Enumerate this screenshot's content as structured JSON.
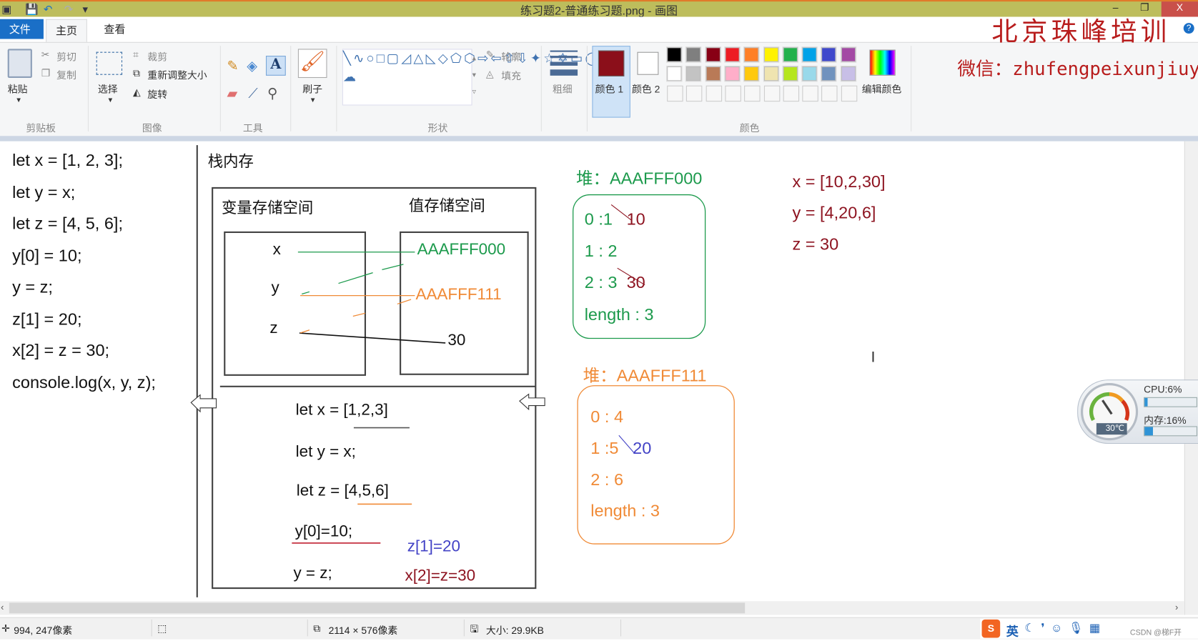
{
  "window": {
    "title": "练习题2-普通练习题.png - 画图",
    "minimize": "–",
    "restore": "❐",
    "close": "X"
  },
  "tabs": [
    {
      "label": "文件"
    },
    {
      "label": "主页"
    },
    {
      "label": "查看"
    }
  ],
  "ribbon": {
    "clipboard": {
      "paste": "粘贴",
      "cut": "剪切",
      "copy": "复制",
      "group": "剪贴板"
    },
    "image": {
      "select": "选择",
      "crop": "裁剪",
      "resize": "重新调整大小",
      "rotate": "旋转",
      "group": "图像"
    },
    "tools": {
      "group": "工具"
    },
    "brushes": {
      "label": "刷子"
    },
    "shapes": {
      "outline": "轮廓",
      "fill": "填充",
      "group": "形状"
    },
    "size": {
      "label": "粗细"
    },
    "colors": {
      "color1": "颜色 1",
      "color2": "颜色 2",
      "edit": "编辑颜色",
      "group": "颜色",
      "color1_value": "#8b0f1a",
      "color2_value": "#ffffff",
      "palette_row1": [
        "#000000",
        "#7f7f7f",
        "#880015",
        "#ed1c24",
        "#ff7f27",
        "#fff200",
        "#22b14c",
        "#00a2e8",
        "#3f48cc",
        "#a349a4"
      ],
      "palette_row2": [
        "#ffffff",
        "#c3c3c3",
        "#b97a57",
        "#ffaec9",
        "#ffc90e",
        "#efe4b0",
        "#b5e61d",
        "#99d9ea",
        "#7092be",
        "#c8bfe7"
      ]
    },
    "help": "?"
  },
  "watermark": {
    "line1": "北京珠峰培训",
    "line2": "微信：zhufengpeixunjiuye"
  },
  "canvas": {
    "code_lines": [
      "let x = [1, 2, 3];",
      "let y = x;",
      "let z = [4, 5, 6];",
      "y[0] = 10;",
      "y = z;",
      "z[1] = 20;",
      "x[2] = z = 30;",
      "console.log(x, y, z);"
    ],
    "stack_title": "栈内存",
    "var_space": "变量存储空间",
    "val_space": "值存储空间",
    "vars": [
      "x",
      "y",
      "z"
    ],
    "values": [
      "AAAFFF000",
      "AAAFFF111",
      "30"
    ],
    "lower_code": [
      "let x = [1,2,3]",
      "let y = x;",
      "let z = [4,5,6]",
      "y[0]=10;",
      "y = z;"
    ],
    "annot_z": "z[1]=20",
    "annot_x": "x[2]=z=30",
    "heap1": {
      "title": "堆：AAAFFF000",
      "rows": [
        {
          "key": "0 :",
          "old": "1",
          "new": "10"
        },
        {
          "key": "1  : 2"
        },
        {
          "key": "2  :",
          "old": "3",
          "new": "30"
        },
        {
          "key": "length  :  3"
        }
      ]
    },
    "heap2": {
      "title": "堆：AAAFFF111",
      "rows": [
        {
          "key": "0 : 4"
        },
        {
          "key": "1 :",
          "old": "5",
          "new": "20"
        },
        {
          "key": "2 : 6"
        },
        {
          "key": "length : 3"
        }
      ]
    },
    "results": [
      "x = [10,2,30]",
      "y = [4,20,6]",
      "z = 30"
    ]
  },
  "monitor": {
    "cpu": "CPU:6%",
    "cpu_pct": 6,
    "mem": "内存:16%",
    "mem_pct": 16,
    "temp": "30℃"
  },
  "status": {
    "cursor": "994, 247像素",
    "dimensions": "2114 × 576像素",
    "size": "大小: 29.9KB"
  },
  "ime": {
    "logo": "S",
    "mode": "英",
    "watermark": "CSDN @梯F开"
  }
}
